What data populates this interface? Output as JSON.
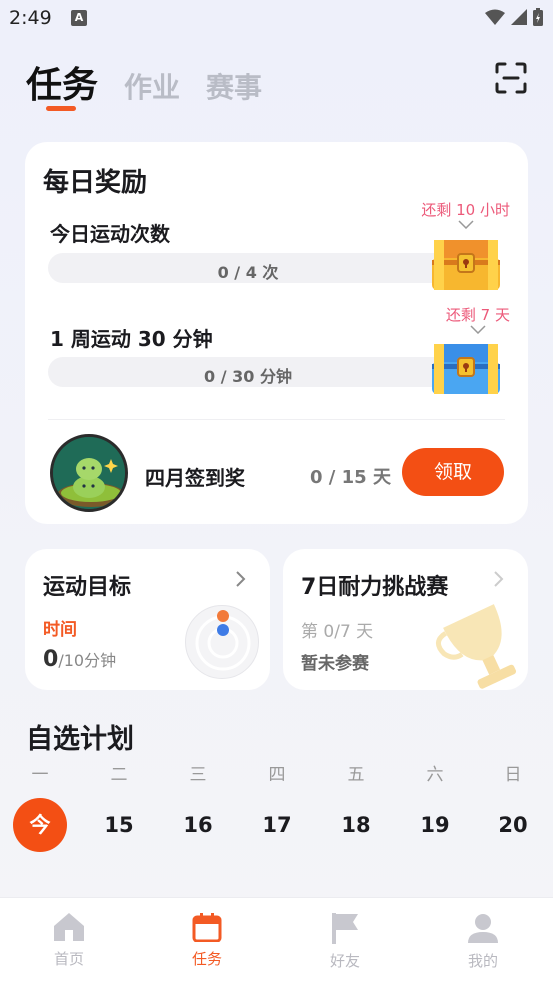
{
  "status": {
    "time": "2:49",
    "indicator": "A"
  },
  "header": {
    "tabs": [
      {
        "label": "任务",
        "active": true
      },
      {
        "label": "作业",
        "active": false
      },
      {
        "label": "赛事",
        "active": false
      }
    ],
    "scan_icon": "scan-icon"
  },
  "daily": {
    "title": "每日奖励",
    "tasks": [
      {
        "label": "今日运动次数",
        "progress": "0 / 4 次",
        "remaining": "还剩 10 小时",
        "progress_fraction": 0
      },
      {
        "label": "1 周运动 30 分钟",
        "progress": "0 / 30 分钟",
        "remaining": "还剩 7 天",
        "progress_fraction": 0
      }
    ],
    "signin": {
      "label": "四月签到奖",
      "progress": "0 / 15 天",
      "button": "领取"
    }
  },
  "goal": {
    "title": "运动目标",
    "sub": "时间",
    "value": "0",
    "unit": "/10分钟"
  },
  "challenge": {
    "title": "7日耐力挑战赛",
    "progress": "第 0/7 天",
    "status": "暂未参赛"
  },
  "plan": {
    "title": "自选计划",
    "days": [
      {
        "weekday": "一",
        "date": "今",
        "today": true
      },
      {
        "weekday": "二",
        "date": "15"
      },
      {
        "weekday": "三",
        "date": "16"
      },
      {
        "weekday": "四",
        "date": "17"
      },
      {
        "weekday": "五",
        "date": "18"
      },
      {
        "weekday": "六",
        "date": "19"
      },
      {
        "weekday": "日",
        "date": "20"
      }
    ]
  },
  "nav": [
    {
      "label": "首页",
      "icon": "home-icon",
      "active": false
    },
    {
      "label": "任务",
      "icon": "calendar-icon",
      "active": true
    },
    {
      "label": "好友",
      "icon": "flag-icon",
      "active": false
    },
    {
      "label": "我的",
      "icon": "profile-icon",
      "active": false
    }
  ],
  "colors": {
    "accent": "#f34f14",
    "remain_text": "#ec5a7a"
  }
}
